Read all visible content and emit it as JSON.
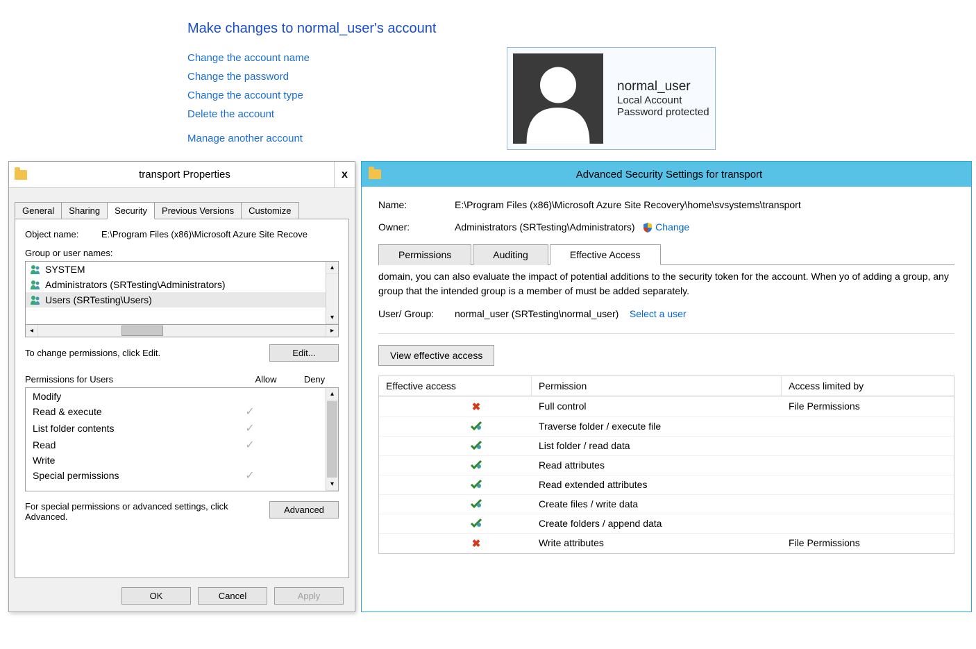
{
  "control_panel": {
    "header": "Make changes to normal_user's account",
    "links": [
      "Change the account name",
      "Change the password",
      "Change the account type",
      "Delete the account",
      "Manage another account"
    ]
  },
  "user_card": {
    "username": "normal_user",
    "type": "Local Account",
    "status": "Password protected"
  },
  "properties_dialog": {
    "title": "transport Properties",
    "tabs": [
      "General",
      "Sharing",
      "Security",
      "Previous Versions",
      "Customize"
    ],
    "active_tab": "Security",
    "object_name_label": "Object name:",
    "object_name": "E:\\Program Files (x86)\\Microsoft Azure Site Recove",
    "group_label": "Group or user names:",
    "groups": [
      "SYSTEM",
      "Administrators (SRTesting\\Administrators)",
      "Users (SRTesting\\Users)"
    ],
    "selected_group_index": 2,
    "edit_hint": "To change permissions, click Edit.",
    "edit_button": "Edit...",
    "perm_header_label": "Permissions for Users",
    "allow_label": "Allow",
    "deny_label": "Deny",
    "permissions": [
      {
        "name": "Modify",
        "allow": false,
        "deny": false
      },
      {
        "name": "Read & execute",
        "allow": true,
        "deny": false
      },
      {
        "name": "List folder contents",
        "allow": true,
        "deny": false
      },
      {
        "name": "Read",
        "allow": true,
        "deny": false
      },
      {
        "name": "Write",
        "allow": false,
        "deny": false
      },
      {
        "name": "Special permissions",
        "allow": true,
        "deny": false
      }
    ],
    "advanced_hint": "For special permissions or advanced settings, click Advanced.",
    "advanced_button": "Advanced",
    "ok": "OK",
    "cancel": "Cancel",
    "apply": "Apply"
  },
  "advanced_window": {
    "title": "Advanced Security Settings for transport",
    "name_label": "Name:",
    "name_value": "E:\\Program Files (x86)\\Microsoft Azure Site Recovery\\home\\svsystems\\transport",
    "owner_label": "Owner:",
    "owner_value": "Administrators (SRTesting\\Administrators)",
    "change_link": "Change",
    "tabs": [
      "Permissions",
      "Auditing",
      "Effective Access"
    ],
    "active_tab": "Effective Access",
    "description": "domain, you can also evaluate the impact of potential additions to the security token for the account. When yo of adding a group, any group that the intended group is a member of must be added separately.",
    "user_group_label": "User/ Group:",
    "user_group_value": "normal_user (SRTesting\\normal_user)",
    "select_user_link": "Select a user",
    "view_button": "View effective access",
    "columns": [
      "Effective access",
      "Permission",
      "Access limited by"
    ],
    "rows": [
      {
        "effect": "deny",
        "permission": "Full control",
        "limited": "File Permissions"
      },
      {
        "effect": "allow",
        "permission": "Traverse folder / execute file",
        "limited": ""
      },
      {
        "effect": "allow",
        "permission": "List folder / read data",
        "limited": ""
      },
      {
        "effect": "allow",
        "permission": "Read attributes",
        "limited": ""
      },
      {
        "effect": "allow",
        "permission": "Read extended attributes",
        "limited": ""
      },
      {
        "effect": "allow",
        "permission": "Create files / write data",
        "limited": ""
      },
      {
        "effect": "allow",
        "permission": "Create folders / append data",
        "limited": ""
      },
      {
        "effect": "deny",
        "permission": "Write attributes",
        "limited": "File Permissions"
      }
    ]
  }
}
